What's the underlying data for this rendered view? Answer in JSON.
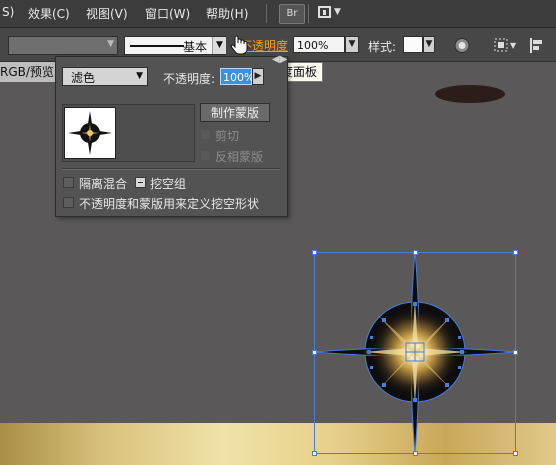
{
  "menubar": {
    "items": [
      "S)",
      "效果(C)",
      "视图(V)",
      "窗口(W)",
      "帮助(H)"
    ],
    "br_badge": "Br"
  },
  "control_bar": {
    "brush_label": "基本",
    "opacity_link": "不透明度",
    "opacity_value": "100%",
    "style_label": "样式:"
  },
  "tooltip": "透明度面板",
  "doc_tab": "RGB/预览",
  "transparency_panel": {
    "blend_mode": "滤色",
    "opacity_label": "不透明度:",
    "opacity_value": "100%",
    "make_mask_button": "制作蒙版",
    "clip_label": "剪切",
    "invert_mask_label": "反相蒙版",
    "isolate_blending_label": "隔离混合",
    "knockout_group_label": "挖空组",
    "opacity_mask_knockout_label": "不透明度和蒙版用来定义挖空形状"
  },
  "colors": {
    "accent_link": "#f59a2a",
    "selection_blue": "#4a7cd8",
    "highlight_blue": "#3e8fdc"
  }
}
